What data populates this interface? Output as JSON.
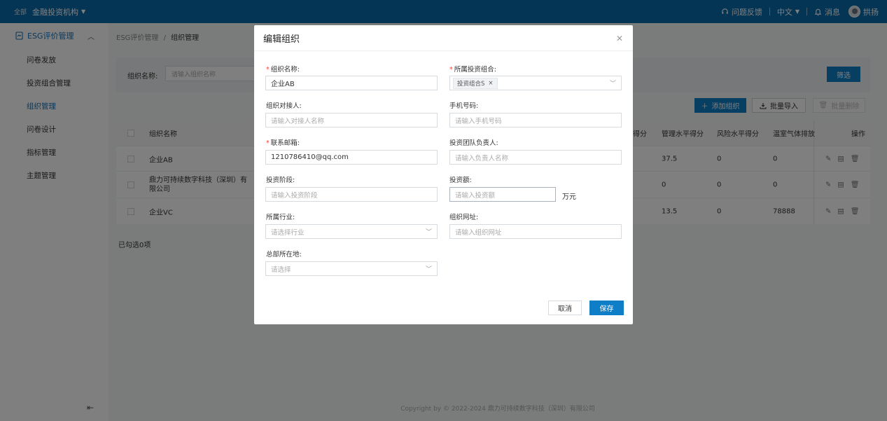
{
  "topbar": {
    "org_label": "全部",
    "org_name": "金融投资机构",
    "feedback": "问题反馈",
    "language": "中文",
    "messages": "消息",
    "user": "拱扬"
  },
  "sidebar": {
    "group": "ESG评价管理",
    "items": [
      {
        "label": "问卷发放"
      },
      {
        "label": "投资组合管理"
      },
      {
        "label": "组织管理"
      },
      {
        "label": "问卷设计"
      },
      {
        "label": "指标管理"
      },
      {
        "label": "主题管理"
      }
    ]
  },
  "breadcrumb": {
    "parent": "ESG评价管理",
    "separator": "/",
    "current": "组织管理"
  },
  "filter": {
    "label": "组织名称:",
    "placeholder": "请输入组织名称",
    "button": "筛选"
  },
  "actions": {
    "add": "添加组织",
    "import": "批量导入",
    "delete": "批量删除"
  },
  "table": {
    "columns": {
      "name": "组织名称",
      "score_a": "得分",
      "management": "管理水平得分",
      "risk": "风险水平得分",
      "ghg": "温室气体排放",
      "ops": "操作"
    },
    "rows": [
      {
        "name": "企业AB",
        "management": "37.5",
        "risk": "0",
        "ghg": "0"
      },
      {
        "name": "鼎力可持续数字科技（深圳）有限公司",
        "management": "0",
        "risk": "0",
        "ghg": "0"
      },
      {
        "name": "企业VC",
        "management": "13.5",
        "risk": "0",
        "ghg": "78888"
      }
    ],
    "selected": "已勾选0项"
  },
  "footer": "Copyright by © 2022-2024 鼎力可持续数字科技（深圳）有限公司",
  "modal": {
    "title": "编辑组织",
    "fields": {
      "org_name": {
        "label": "组织名称:",
        "value": "企业AB"
      },
      "portfolio": {
        "label": "所属投资组合:",
        "tag": "投资组合S"
      },
      "contact": {
        "label": "组织对接人:",
        "placeholder": "请输入对接人名称"
      },
      "phone": {
        "label": "手机号码:",
        "placeholder": "请输入手机号码"
      },
      "email": {
        "label": "联系邮箱:",
        "value": "1210786410@qq.com"
      },
      "team_lead": {
        "label": "投资团队负责人:",
        "placeholder": "请输入负责人名称"
      },
      "stage": {
        "label": "投资阶段:",
        "placeholder": "请输入投资阶段"
      },
      "amount": {
        "label": "投资额:",
        "placeholder": "请输入投资额",
        "unit": "万元"
      },
      "industry": {
        "label": "所属行业:",
        "placeholder": "请选择行业"
      },
      "website": {
        "label": "组织网址:",
        "placeholder": "请输入组织网址"
      },
      "hq": {
        "label": "总部所在地:",
        "placeholder": "请选择"
      }
    },
    "cancel": "取消",
    "save": "保存"
  }
}
